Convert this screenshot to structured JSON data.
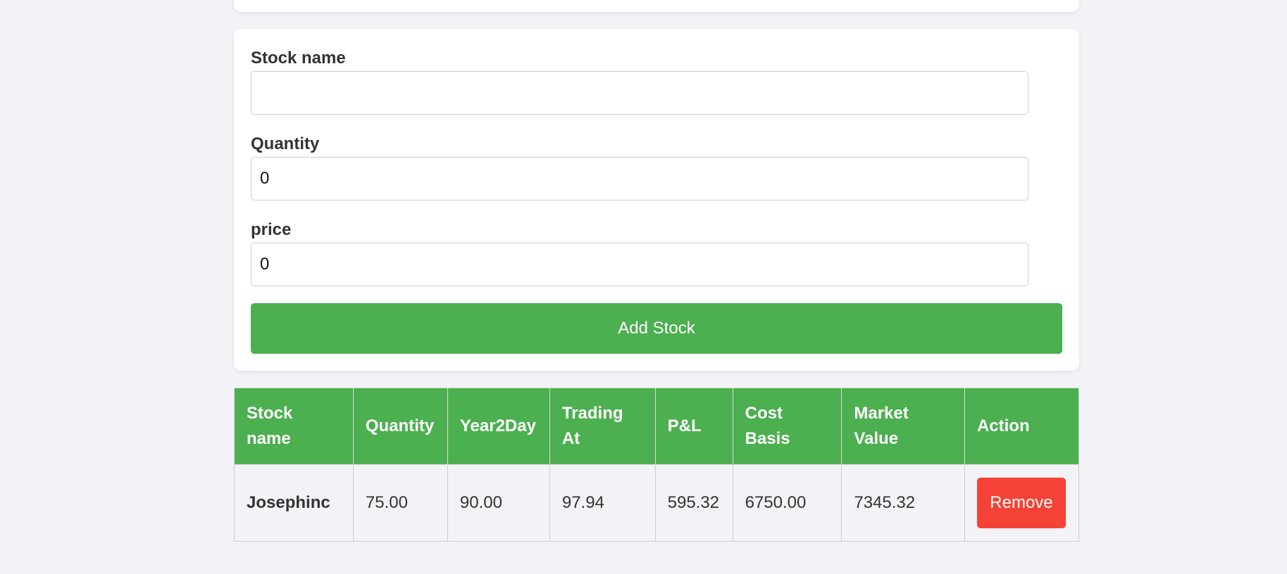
{
  "form": {
    "stock_name": {
      "label": "Stock name",
      "value": ""
    },
    "quantity": {
      "label": "Quantity",
      "value": "0"
    },
    "price": {
      "label": "price",
      "value": "0"
    },
    "add_button_label": "Add Stock"
  },
  "table": {
    "headers": {
      "stock_name_line1": "Stock",
      "stock_name_line2": "name",
      "quantity": "Quantity",
      "year2day": "Year2Day",
      "trading_at_line1": "Trading",
      "trading_at_line2": "At",
      "pnl": "P&L",
      "cost_basis_line1": "Cost",
      "cost_basis_line2": "Basis",
      "market_value_line1": "Market",
      "market_value_line2": "Value",
      "action": "Action"
    },
    "rows": [
      {
        "stock_name": "Josephinc",
        "quantity": "75.00",
        "year2day": "90.00",
        "trading_at": "97.94",
        "pnl": "595.32",
        "cost_basis": "6750.00",
        "market_value": "7345.32",
        "action_label": "Remove"
      }
    ]
  },
  "colors": {
    "accent_green": "#4caf50",
    "positive_value": "#1ed21e",
    "danger_red": "#f44336",
    "page_background": "#f3f2f7"
  }
}
